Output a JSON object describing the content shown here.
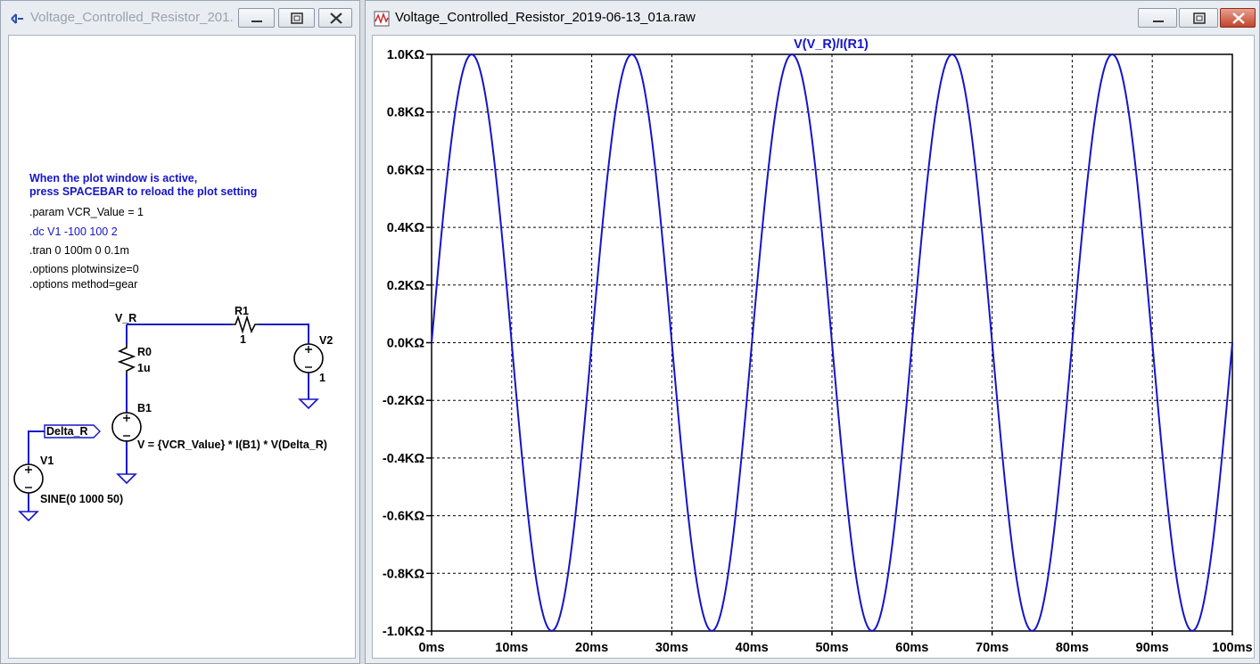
{
  "schematic_window": {
    "title": "Voltage_Controlled_Resistor_201...",
    "buttons": [
      "minimize-button",
      "maximize-button",
      "close-button"
    ],
    "note_line1": "When the plot window is active,",
    "note_line2": "press SPACEBAR to reload the plot setting",
    "directives": {
      "param": ".param VCR_Value = 1",
      "dc": ".dc V1 -100 100 2",
      "tran": ".tran 0 100m 0 0.1m",
      "opt1": ".options plotwinsize=0",
      "opt2": ".options method=gear"
    },
    "components": {
      "net_vr": "V_R",
      "r1_name": "R1",
      "r1_value": "1",
      "r0_name": "R0",
      "r0_value": "1u",
      "v2_name": "V2",
      "v2_value": "1",
      "b1_name": "B1",
      "b1_expr": "V = {VCR_Value} * I(B1) * V(Delta_R)",
      "net_delta": "Delta_R",
      "v1_name": "V1",
      "v1_value": "SINE(0 1000 50)"
    },
    "colors": {
      "directive_blue": "#1515c8",
      "wire_blue": "#1515c8",
      "text": "#000000"
    }
  },
  "plot_window": {
    "title": "Voltage_Controlled_Resistor_2019-06-13_01a.raw",
    "buttons": [
      "minimize-button",
      "maximize-button",
      "close-button"
    ]
  },
  "chart_data": {
    "type": "line",
    "title": "V(V_R)/I(R1)",
    "xlabel": "",
    "ylabel": "",
    "xlim": [
      0,
      100
    ],
    "ylim": [
      -1.0,
      1.0
    ],
    "x_tick_labels": [
      "0ms",
      "10ms",
      "20ms",
      "30ms",
      "40ms",
      "50ms",
      "60ms",
      "70ms",
      "80ms",
      "90ms",
      "100ms"
    ],
    "y_tick_labels": [
      "1.0KΩ",
      "0.8KΩ",
      "0.6KΩ",
      "0.4KΩ",
      "0.2KΩ",
      "0.0KΩ",
      "-0.2KΩ",
      "-0.4KΩ",
      "-0.6KΩ",
      "-0.8KΩ",
      "-1.0KΩ"
    ],
    "grid": true,
    "series": [
      {
        "name": "V(V_R)/I(R1)",
        "color": "#1515c8",
        "x": [
          0,
          5,
          10,
          15,
          20,
          25,
          30,
          35,
          40,
          45,
          50,
          55,
          60,
          65,
          70,
          75,
          80,
          85,
          90,
          95,
          100
        ],
        "y": [
          0,
          1.0,
          0,
          -1.0,
          0,
          1.0,
          0,
          -1.0,
          0,
          1.0,
          0,
          -1.0,
          0,
          1.0,
          0,
          -1.0,
          0,
          1.0,
          0,
          -1.0,
          0
        ]
      }
    ]
  }
}
